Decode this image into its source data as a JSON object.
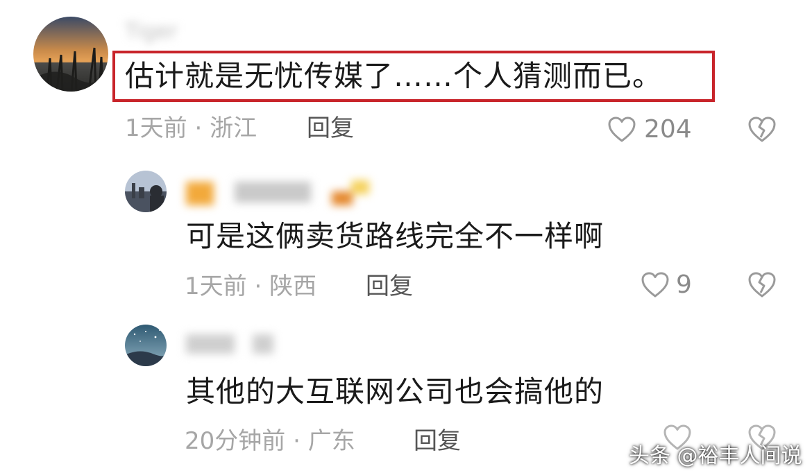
{
  "comments": [
    {
      "username": "Tiger",
      "text": "估计就是无忧传媒了……个人猜测而已。",
      "time": "1天前",
      "location": "浙江",
      "reply_label": "回复",
      "likes": "204"
    },
    {
      "username": "",
      "text": "可是这俩卖货路线完全不一样啊",
      "time": "1天前",
      "location": "陕西",
      "reply_label": "回复",
      "likes": "9"
    },
    {
      "username": "",
      "text": "其他的大互联网公司也会搞他的",
      "time": "20分钟前",
      "location": "广东",
      "reply_label": "回复",
      "likes": ""
    }
  ],
  "meta_separator": " · ",
  "watermark": "头条 @裕丰人间说",
  "colors": {
    "highlight": "#c8242a",
    "meta_gray": "#a6a6a6",
    "icon_gray": "#9a9a9a"
  },
  "icons": [
    "heart-outline-icon",
    "broken-heart-icon"
  ]
}
